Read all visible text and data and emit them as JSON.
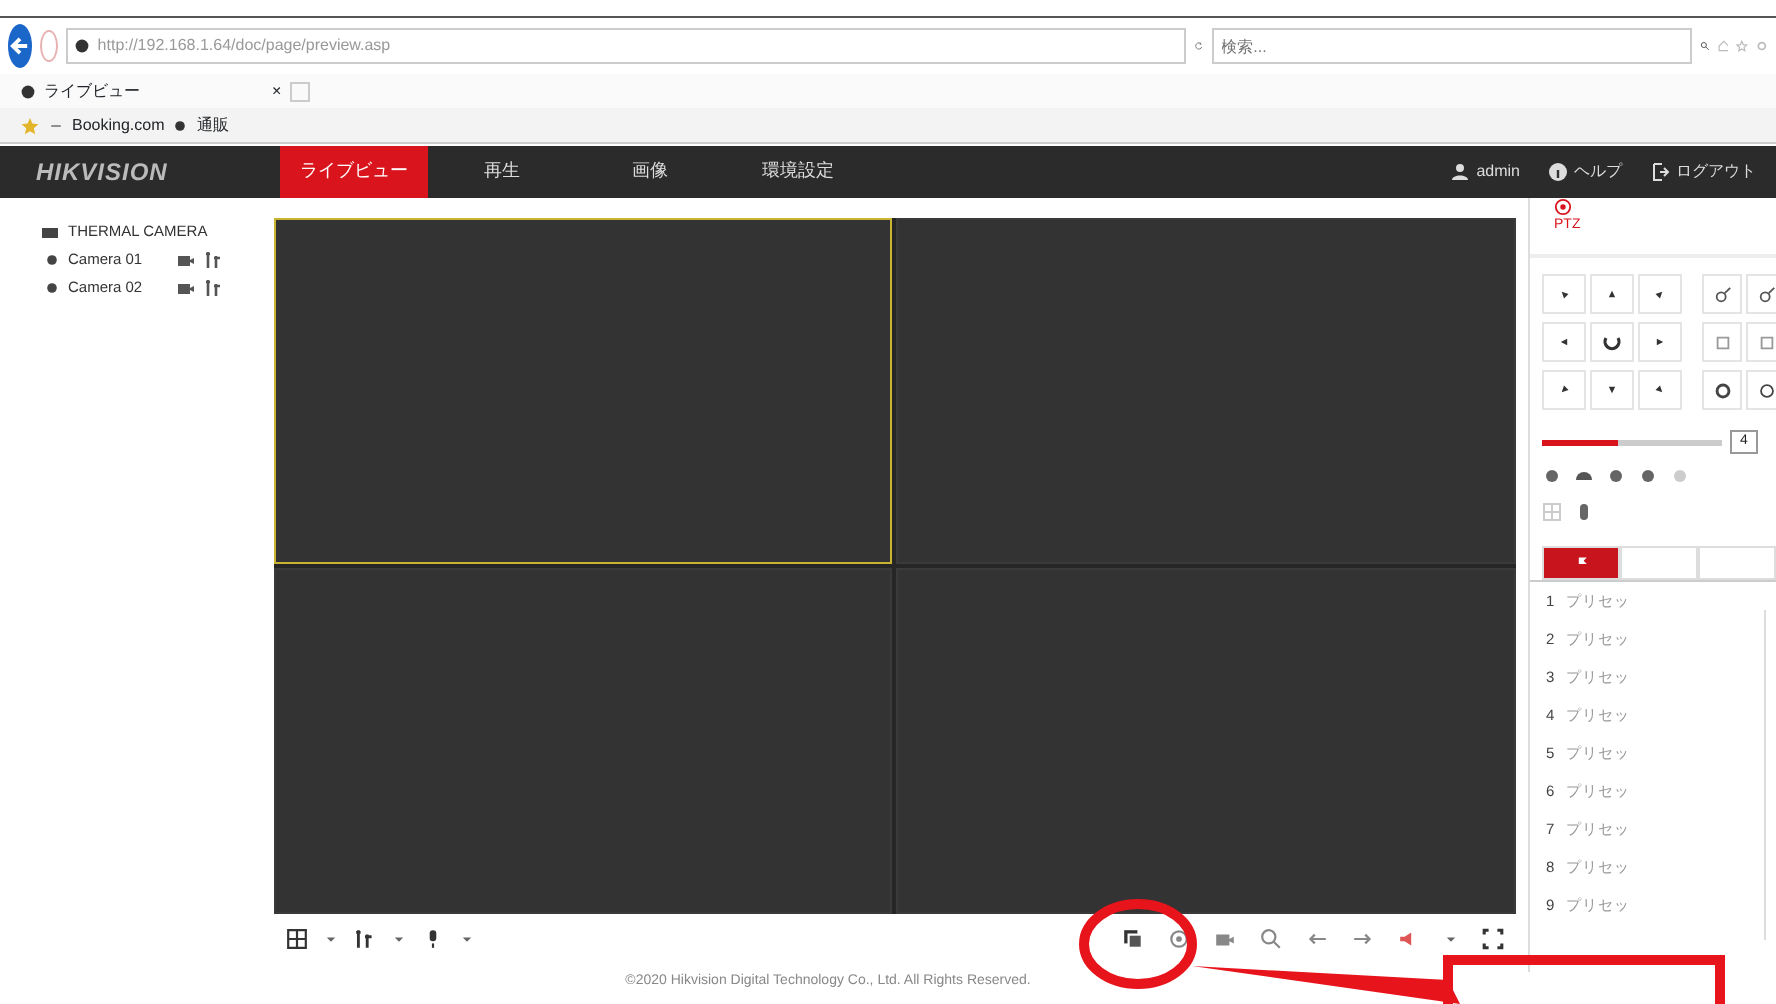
{
  "browser": {
    "url": "http://192.168.1.64/doc/page/preview.asp",
    "search_placeholder": "検索...",
    "tab": {
      "title": "ライブビュー",
      "close": "×"
    },
    "favorites": [
      "Booking.com",
      "通販"
    ]
  },
  "app": {
    "logo": "HIKVISION",
    "nav": [
      {
        "label": "ライブビュー",
        "selected": true
      },
      {
        "label": "再生",
        "selected": false
      },
      {
        "label": "画像",
        "selected": false
      },
      {
        "label": "環境設定",
        "selected": false
      }
    ],
    "user": "admin",
    "help": "ヘルプ",
    "logout": "ログアウト"
  },
  "device_tree": {
    "group": "THERMAL CAMERA",
    "cameras": [
      "Camera 01",
      "Camera 02"
    ]
  },
  "video_grid": {
    "windows": [
      {
        "selected": true
      },
      {
        "selected": false
      },
      {
        "selected": false
      },
      {
        "selected": false
      }
    ]
  },
  "ptz": {
    "title": "PTZ",
    "speed": {
      "level": 0.42,
      "value": "4"
    },
    "tabs": [
      {
        "selected": true
      },
      {
        "selected": false
      },
      {
        "selected": false
      }
    ],
    "presets": [
      {
        "number": "1",
        "label": "プリセッ"
      },
      {
        "number": "2",
        "label": "プリセッ"
      },
      {
        "number": "3",
        "label": "プリセッ"
      },
      {
        "number": "4",
        "label": "プリセッ"
      },
      {
        "number": "5",
        "label": "プリセッ"
      },
      {
        "number": "6",
        "label": "プリセッ"
      },
      {
        "number": "7",
        "label": "プリセッ"
      },
      {
        "number": "8",
        "label": "プリセッ"
      },
      {
        "number": "9",
        "label": "プリセッ"
      }
    ]
  },
  "footer": "©2020 Hikvision Digital Technology Co., Ltd. All Rights Reserved."
}
